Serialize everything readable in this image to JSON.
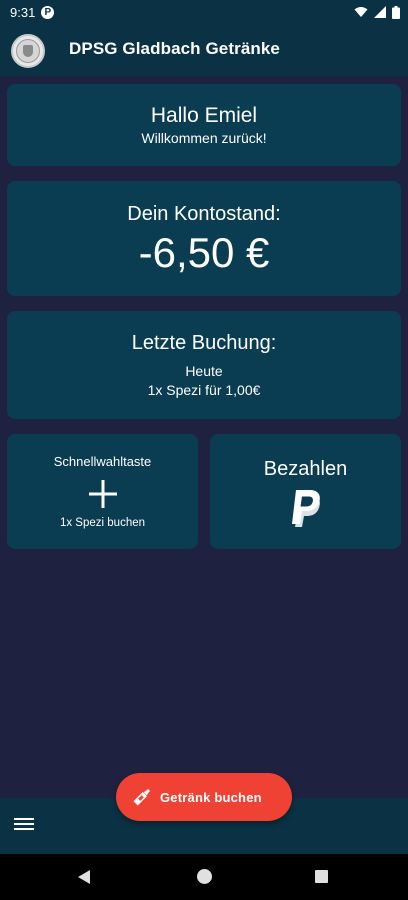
{
  "status_bar": {
    "time": "9:31",
    "notification_icon": "p-circle-icon",
    "icons": [
      "wifi-icon",
      "signal-icon",
      "battery-icon"
    ]
  },
  "app_bar": {
    "title": "DPSG Gladbach Getränke",
    "logo_icon": "dpsg-logo-icon"
  },
  "greeting": {
    "title": "Hallo Emiel",
    "subtitle": "Willkommen zurück!"
  },
  "balance": {
    "label": "Dein Kontostand:",
    "value": "-6,50 €"
  },
  "last_booking": {
    "label": "Letzte Buchung:",
    "date": "Heute",
    "detail": "1x Spezi für 1,00€"
  },
  "quick_button": {
    "label": "Schnellwahltaste",
    "icon": "plus-icon",
    "sub": "1x Spezi buchen"
  },
  "pay": {
    "label": "Bezahlen",
    "icon": "paypal-icon"
  },
  "fab": {
    "label": "Getränk buchen",
    "icon": "bottle-icon"
  },
  "bottom_bar": {
    "menu_icon": "hamburger-menu-icon"
  },
  "colors": {
    "background": "#1e2140",
    "card": "#0a3c52",
    "bar": "#0a3244",
    "fab": "#ef4134"
  }
}
